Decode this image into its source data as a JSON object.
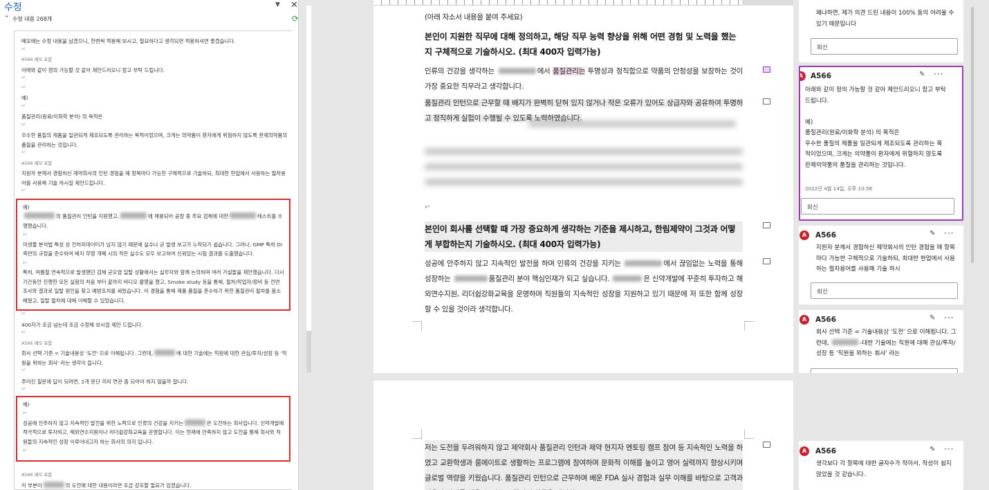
{
  "revisions_pane": {
    "title": "수정",
    "count_label": "수정 내용 268개",
    "items": [
      {
        "text": "메모에는 수정 내용을 남겼으니, 한번씩 적용해 보시고, 필요하다고 생각되면 적용하셔면 좋겠습니다."
      },
      {
        "who": "A566 메모 포함",
        "text": "아래와 같이 정의 가능할 것 같아 제안드리오니 참고 부탁 드립니다."
      },
      {
        "text": "예)"
      },
      {
        "text": "품질관리(원료/이화학 분석) 의 목적은"
      },
      {
        "text": "우수한 품질의 제품을 일관되게 제조되도록 관리하는 목적이었으며, 크게는 의약품이 환자에게 위험하지 않도록 완제의약품의 품질을 관리하는 것입니다."
      },
      {
        "who": "A566 메모 포함",
        "text": "지원자 분께서 경험하신 제약회사의 인턴 경험을 예 항목마다 가능한 구체적으로 기술하되, 최대한 현업에서 사용하는 절차용어를 사용해 기술 하시길 제안드립니다."
      }
    ],
    "box1": {
      "p0": "예)",
      "p1a": "의 품질관리 인턴을 지원했고,",
      "p1b": "에 채용되어 공정 중 주요 검체에 대한",
      "p1c": "테스트를 수행했습니다.",
      "p2": "미생물 분석법 특성 상 전처리데이터가 남지 않기 때문에 실수나 균 발생 보고가 누락되기 쉽습니다. 그러나, GMP 특히 DI 측면의 규정을 준수하여 배지 무영 개폐 시의 작은 실수도 모두 보고하여 신뢰있는 시험 결과를 도출했습니다.",
      "p3": "특히, 여름철 연속적으로 발생했던 검체 균오염 일탈 상황에서는 실무자와 함께 논의하며 여러 가설들을 제안했습니다. 다시 기간동안 진행한 모든 실험의 처음 부터 끝까지 비디오 촬영을 했고, Smoke study 등을 통해, 절차/작업자/장비 등 전면 조사와 결과로 일탈 원인을 찾고 예방조치를 세웠습니다. 이 경험을 통해 제품 품질을 준수하기 위한 품질관리 절차를 몸소 배웠고, 일탈 절차에 대해 이해할 수 있었습니다."
    },
    "mid1": "400자가 조금 넘는데 조금 수정해 보시길 제안 드립니다.",
    "mid2_who": "A566 메모 포함",
    "mid2a": "회사 선택 기준 = 기술내용상 '도전' 으로 이해됩니다. 그런데,",
    "mid2b": "에 대한 기술에는 직원에 대한 관심/투자/성장 등 '직원을 위하는 회사' 라는 생각이 듭니다.",
    "mid3": "주어진 질문에 답이 되려면, 2개 문단 끼리 연관 좀 되어야 하지 않을까 합니다.",
    "box2": {
      "p0": "예)",
      "p1a": "성공에 안주하지 않고 지속적인 발전을 위한 노력으로 인류의 건강을 지키는",
      "p1b": "은 도전하는 회사입니다. 신약개발에 적극적으로 투자하고, 해외연수지원이나 리더쉽강화교육을 운영합니다. 이는 현재에 만족하지 않고 도전을 통해 회사와 직원들의 지속적인 성장 이루어내고자 하는 회사의 의지 입니다."
    },
    "last_who": "A566 메모 포함",
    "last_a": "이 부분이",
    "last_b": "의 도전에 대한 내용이라면 조금 강조할 필요가 있겠습니다."
  },
  "document": {
    "intro": "(아래 자소서 내용을 붙여 주세요)",
    "q1": "본인이 지원한 직무에 대해 정의하고, 해당 직무 능력 향상을 위해 어떤 경험 및 노력을 했는지 구체적으로 기술하시오. (최대 400자 입력가능)",
    "a1_pre": "인류의 건강을 생각하는",
    "a1_mid": "에서",
    "a1_hl": "품질관리는",
    "a1_post": "투명성과 정직함으로 약품의 안정성을 보장하는 것이 가장 중요한 직무라고 생각합니다.",
    "a2": "품질관리 인턴으로 근무할 때 배지가 완벽히 닫혀 있지 않거나 작은 오류가 있어도 상급자와 공유하여 투명하고 정직하게 실험이 수행될 수 있도록 노력하였습니다.",
    "q2": "본인이 회사를 선택할 때 가장 중요하게 생각하는 기준을 제시하고, 한림제약이 그것과 어떻게 부합하는지 기술하시오. (최대 400자 입력가능)",
    "a3_pre": "성공에 안주하지 않고 지속적인 발전을 하며 인류의 건강을 지키는",
    "a3_mid": "에서 끊임없는 노력을 통해 성장하는",
    "a3_mid2": "품질관리 분야 핵심인재가 되고 싶습니다.",
    "a3_post": "은 신약개발에 꾸준히 투자하고 해외연수지원, 리더쉽강화교육을 운영하며 직원들의 지속적인 성장을 지원하고 있기 때문에 저 또한 함께 성장할 수 있을 것이라 생각합니다.",
    "p2_text": "저는 도전을 두려워하지 않고 제약회사 품질관리 인턴과 제약 현지자 멘토링 캠프 참여 등 지속적인 노력을 하였고 교환학생과 룸메이트로 생활하는 프로그램에 참여하며 문화적 이해를 높이고 영어 실력까지 향상시키며 글로벌 역량을 키웠습니다. 품질관리 인턴으로 근무하며 배운 FDA 실사 경험과 실무 이해를 바탕으로 고객과 믿음과 신뢰를 쌓을 수 있는 고품질의 약품을 생산하"
  },
  "comments": {
    "top": {
      "text": "왜냐하면, 제가 의견 드린 내용이 100% 동의 어려울 수 있기 때문입니다",
      "reply": "회신"
    },
    "c1": {
      "author": "A566",
      "avatar": "A",
      "text": "아래와 같이 정의 가능할 것 같아 제안드리오니 참고 부탁 드립니다.\n\n예)\n품질관리(원료/이화학 분석) 의 목적은\n우수한 품질의 제품을 일관되게 제조되도록 관리하는 목적이었으며, 크게는 의약품이 환자에게 위험하지 않도록 완제의약품의 품질을 관리하는 것입니다.",
      "date": "2022년 4월 14일, 오후 10:56",
      "reply": "회신"
    },
    "c2": {
      "author": "A566",
      "avatar": "A",
      "text": "지원자 분께서 경험하신 제약회사의 인턴 경험을 매 항목마다 가능한 구체적으로 기술하되, 최대한 현업에서 사용하는 절차용어를 사용해 기술 하시",
      "reply": "회신"
    },
    "c3": {
      "author": "A566",
      "avatar": "A",
      "text_a": "회사 선택 기준 = 기술내용상 '도전' 으로 이해됩니다. 그런데,",
      "text_b": "-대한 기술에는 직원에 대해 관심/투자/성장 등 '직원을 위하는 회사' 라는",
      "reply": "회신"
    },
    "c4": {
      "author": "A566",
      "avatar": "A",
      "text": "생각보다 각 항목에 대한 글자수가 작아서, 작성이 쉽지 않았을 것 같습니다."
    }
  },
  "icons": [
    "chevron-down-icon",
    "close-icon",
    "refresh-icon",
    "pencil-icon",
    "more-icon",
    "comment-icon"
  ]
}
